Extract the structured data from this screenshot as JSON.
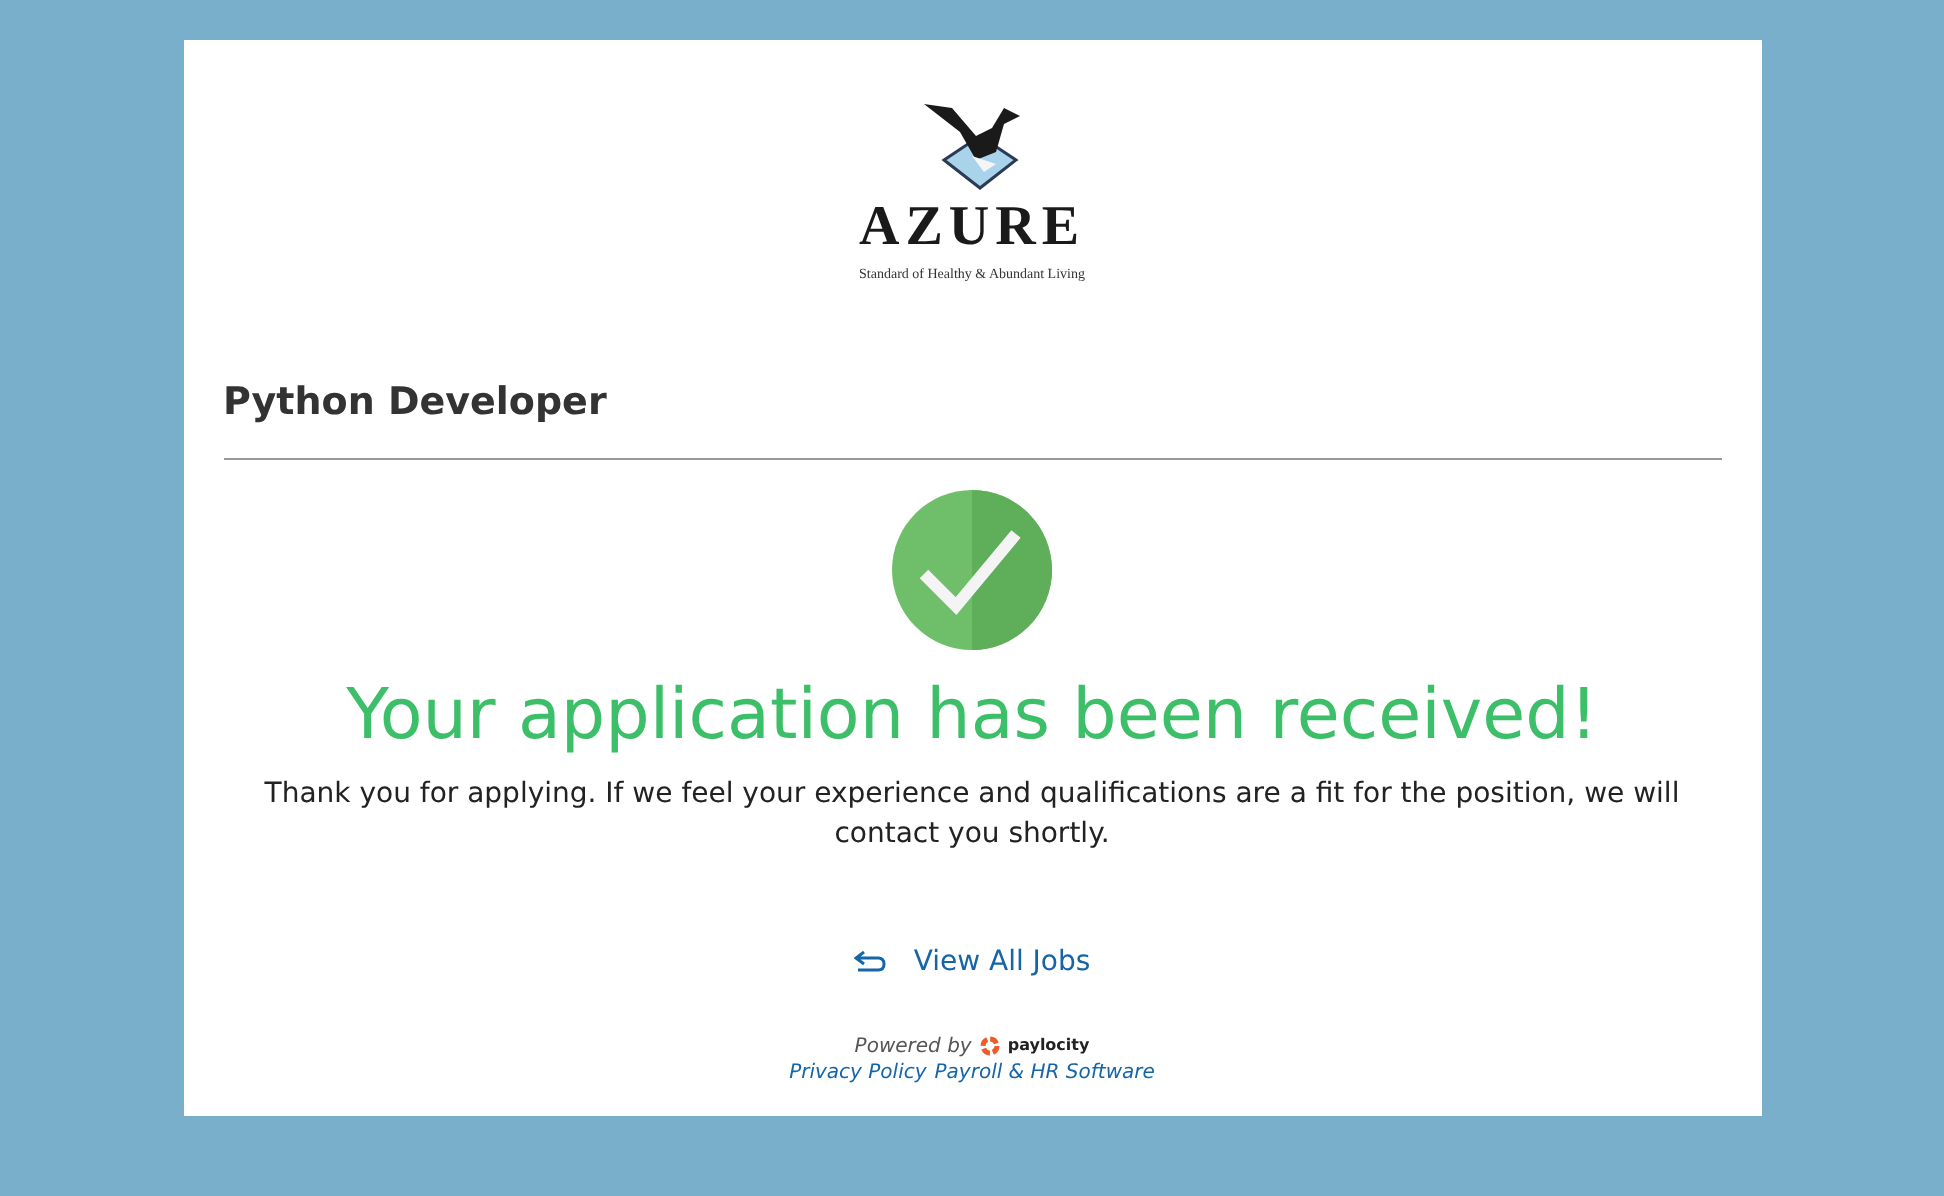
{
  "logo": {
    "name": "AZURE",
    "tagline": "Standard of Healthy & Abundant Living"
  },
  "job_title": "Python Developer",
  "confirmation": {
    "heading": "Your application has been received!",
    "message": "Thank you for applying. If we feel your experience and qualifications are a fit for the position, we will contact you shortly."
  },
  "view_all_jobs": "View All Jobs",
  "footer": {
    "powered_by": "Powered by",
    "brand": "paylocity",
    "links": [
      "Privacy Policy",
      "Payroll & HR Software"
    ]
  }
}
